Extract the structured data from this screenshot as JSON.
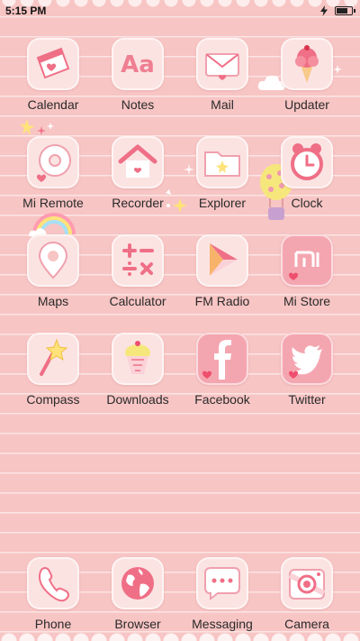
{
  "status_bar": {
    "time": "5:15 PM"
  },
  "colors": {
    "wallpaper": "#f7c5c4",
    "icon_tile": "#fbe3e2",
    "accent": "#ef6f86",
    "label": "#2a2a2a"
  },
  "apps": [
    {
      "label": "Calendar",
      "icon": "calendar-icon"
    },
    {
      "label": "Notes",
      "icon": "notes-icon"
    },
    {
      "label": "Mail",
      "icon": "mail-icon"
    },
    {
      "label": "Updater",
      "icon": "updater-icon"
    },
    {
      "label": "Mi Remote",
      "icon": "mi-remote-icon"
    },
    {
      "label": "Recorder",
      "icon": "recorder-icon"
    },
    {
      "label": "Explorer",
      "icon": "explorer-icon"
    },
    {
      "label": "Clock",
      "icon": "clock-icon"
    },
    {
      "label": "Maps",
      "icon": "maps-icon"
    },
    {
      "label": "Calculator",
      "icon": "calculator-icon"
    },
    {
      "label": "FM Radio",
      "icon": "fm-radio-icon"
    },
    {
      "label": "Mi Store",
      "icon": "mi-store-icon"
    },
    {
      "label": "Compass",
      "icon": "compass-icon"
    },
    {
      "label": "Downloads",
      "icon": "downloads-icon"
    },
    {
      "label": "Facebook",
      "icon": "facebook-icon"
    },
    {
      "label": "Twitter",
      "icon": "twitter-icon"
    }
  ],
  "dock": [
    {
      "label": "Phone",
      "icon": "phone-icon"
    },
    {
      "label": "Browser",
      "icon": "browser-icon"
    },
    {
      "label": "Messaging",
      "icon": "messaging-icon"
    },
    {
      "label": "Camera",
      "icon": "camera-icon"
    }
  ]
}
